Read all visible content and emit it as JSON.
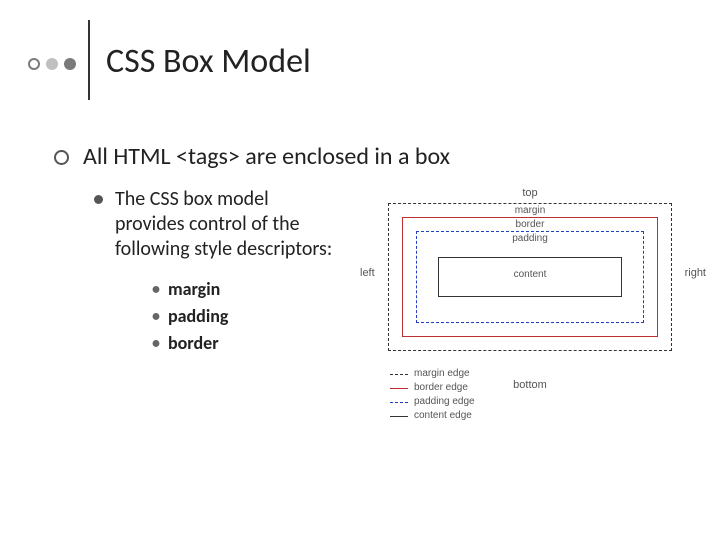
{
  "slide": {
    "title": "CSS Box Model",
    "main_bullet": "All HTML <tags> are enclosed in a box",
    "sub_bullet": "The CSS box model provides control of the following style descriptors:",
    "descriptors": [
      "margin",
      "padding",
      "border"
    ]
  },
  "diagram": {
    "labels": {
      "top": "top",
      "left": "left",
      "right": "right",
      "bottom": "bottom",
      "margin": "margin",
      "border": "border",
      "padding": "padding",
      "content": "content"
    },
    "legend": [
      {
        "style": "dash",
        "label": "margin edge"
      },
      {
        "style": "red",
        "label": "border edge"
      },
      {
        "style": "blue",
        "label": "padding edge"
      },
      {
        "style": "solid",
        "label": "content edge"
      }
    ]
  }
}
